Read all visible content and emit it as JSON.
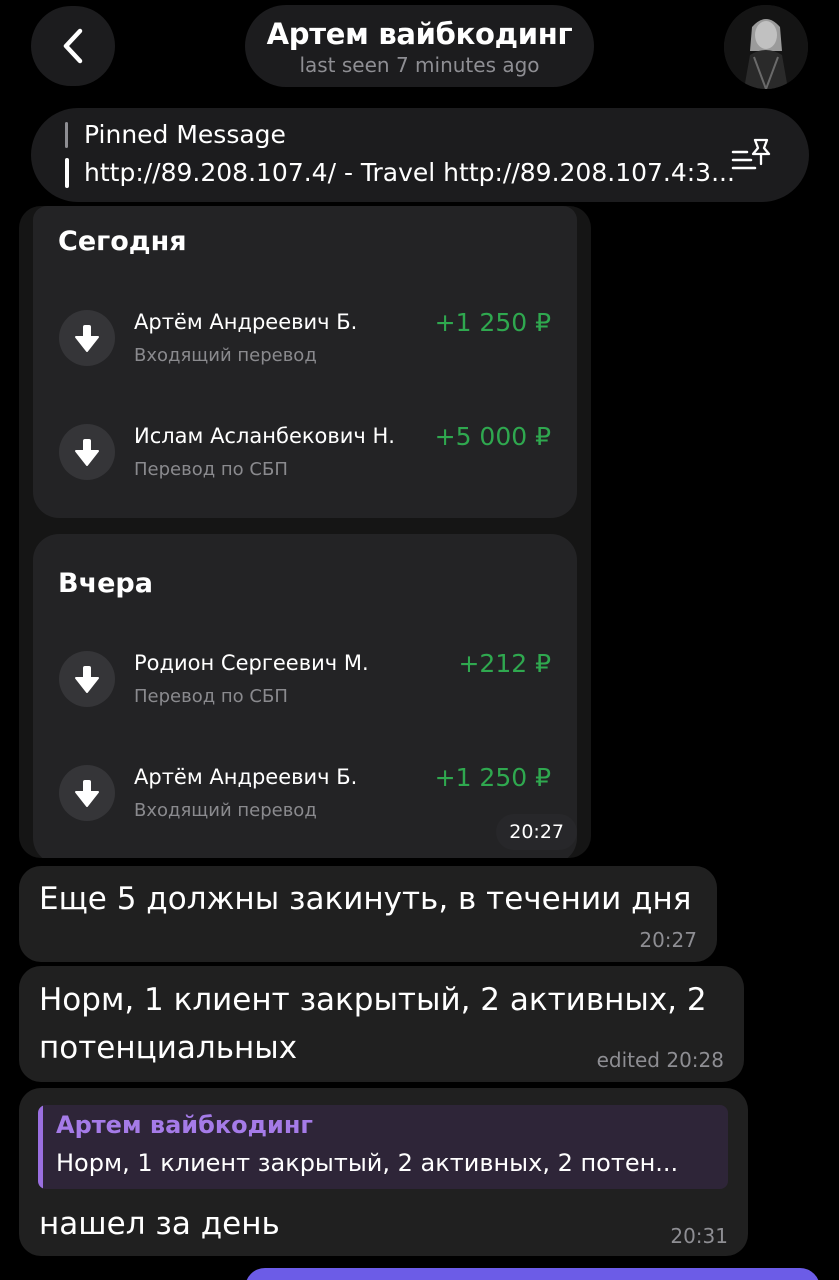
{
  "header": {
    "name": "Артем вайбкодинг",
    "status": "last seen 7 minutes ago"
  },
  "pinned": {
    "title": "Pinned Message",
    "text": "http://89.208.107.4/ - Travel http://89.208.107.4:3..."
  },
  "screenshot": {
    "today_label": "Сегодня",
    "yesterday_label": "Вчера",
    "today": [
      {
        "name": "Артём Андреевич Б.",
        "sub": "Входящий перевод",
        "amount": "+1 250 ₽"
      },
      {
        "name": "Ислам Асланбекович Н.",
        "sub": "Перевод по СБП",
        "amount": "+5 000 ₽"
      }
    ],
    "yesterday": [
      {
        "name": "Родион Сергеевич М.",
        "sub": "Перевод по СБП",
        "amount": "+212 ₽"
      },
      {
        "name": "Артём Андреевич Б.",
        "sub": "Входящий перевод",
        "amount": "+1 250 ₽"
      }
    ],
    "time": "20:27",
    "amount_color": "#2fa84f"
  },
  "messages": [
    {
      "text": "Еще 5 должны закинуть, в течении дня",
      "time": "20:27"
    },
    {
      "text_line1": "Норм, 1 клиент закрытый, 2 активных, 2",
      "text_line2": "потенциальных",
      "time": "edited 20:28"
    },
    {
      "reply_name": "Артем вайбкодинг",
      "reply_text": "Норм, 1 клиент закрытый, 2 активных, 2 потен...",
      "text": "нашел за день",
      "time": "20:31"
    }
  ],
  "icons": {
    "back": "chevron-left-icon",
    "pin": "pin-list-icon",
    "arrow": "arrow-down-icon"
  },
  "colors": {
    "accent_purple": "#a57be8",
    "bubble": "#202020"
  }
}
